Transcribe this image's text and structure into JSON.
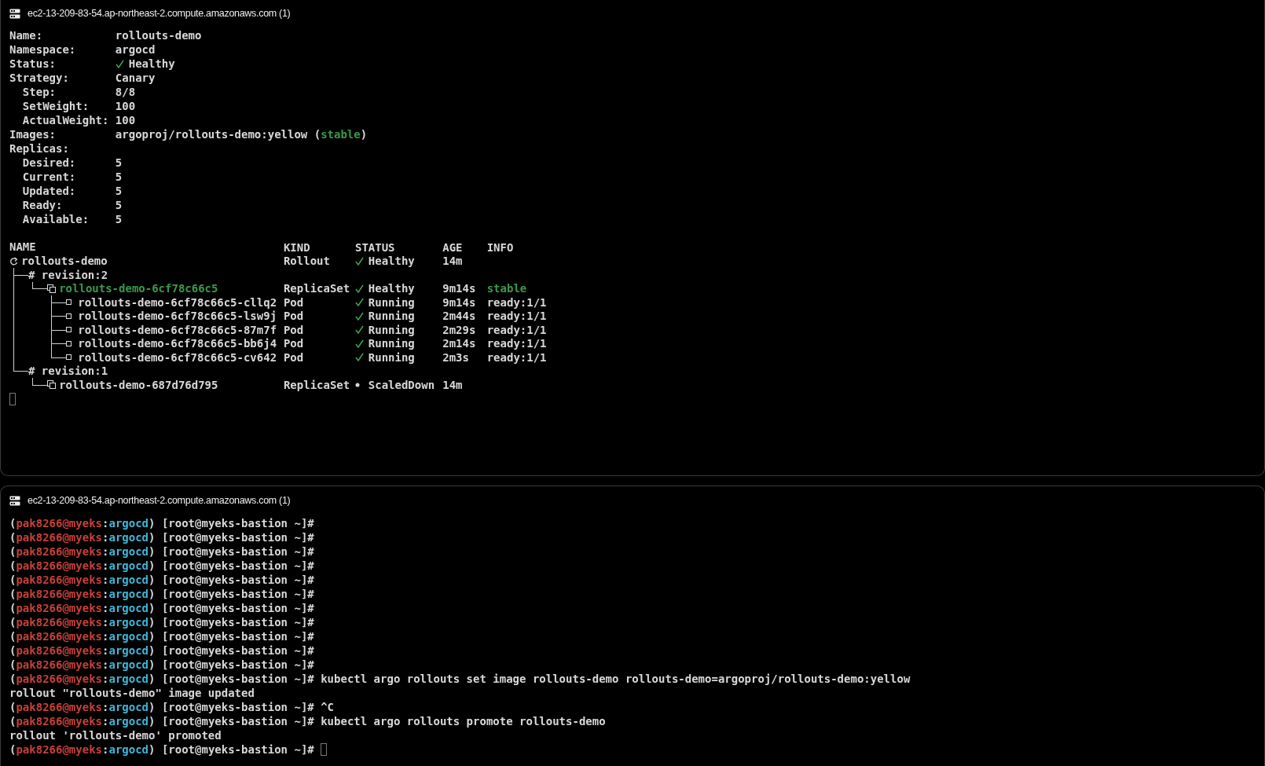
{
  "panes": [
    {
      "kind": "rollout",
      "title": "ec2-13-209-83-54.ap-northeast-2.compute.amazonaws.com (1)",
      "details": [
        {
          "label": "Name:",
          "indent": false,
          "parts": [
            {
              "text": "rollouts-demo",
              "kind": "plain"
            }
          ]
        },
        {
          "label": "Namespace:",
          "indent": false,
          "parts": [
            {
              "text": "argocd",
              "kind": "plain"
            }
          ]
        },
        {
          "label": "Status:",
          "indent": false,
          "parts": [
            {
              "text": "Healthy",
              "kind": "healthy"
            }
          ]
        },
        {
          "label": "Strategy:",
          "indent": false,
          "parts": [
            {
              "text": "Canary",
              "kind": "plain"
            }
          ]
        },
        {
          "label": "Step:",
          "indent": true,
          "parts": [
            {
              "text": "8/8",
              "kind": "plain"
            }
          ]
        },
        {
          "label": "SetWeight:",
          "indent": true,
          "parts": [
            {
              "text": "100",
              "kind": "plain"
            }
          ]
        },
        {
          "label": "ActualWeight:",
          "indent": true,
          "parts": [
            {
              "text": "100",
              "kind": "plain"
            }
          ]
        },
        {
          "label": "Images:",
          "indent": false,
          "parts": [
            {
              "text": "argoproj/rollouts-demo:yellow (",
              "kind": "plain"
            },
            {
              "text": "stable",
              "kind": "stable"
            },
            {
              "text": ")",
              "kind": "plain"
            }
          ]
        },
        {
          "label": "Replicas:",
          "indent": false
        },
        {
          "label": "Desired:",
          "indent": true,
          "parts": [
            {
              "text": "5",
              "kind": "plain"
            }
          ]
        },
        {
          "label": "Current:",
          "indent": true,
          "parts": [
            {
              "text": "5",
              "kind": "plain"
            }
          ]
        },
        {
          "label": "Updated:",
          "indent": true,
          "parts": [
            {
              "text": "5",
              "kind": "plain"
            }
          ]
        },
        {
          "label": "Ready:",
          "indent": true,
          "parts": [
            {
              "text": "5",
              "kind": "plain"
            }
          ]
        },
        {
          "label": "Available:",
          "indent": true,
          "parts": [
            {
              "text": "5",
              "kind": "plain"
            }
          ]
        }
      ],
      "tree": {
        "columns": [
          "NAME",
          "KIND",
          "STATUS",
          "AGE",
          "INFO"
        ],
        "root": {
          "kind": "rollout",
          "name": "rollouts-demo",
          "color": "#d8d8d8",
          "resource_kind": "Rollout",
          "status": {
            "text": "Healthy",
            "kind": "ok"
          },
          "age": "14m",
          "children": [
            {
              "name": "# revision:2",
              "color": "#d8d8d8",
              "children": [
                {
                  "kind": "replicaset",
                  "name": "rollouts-demo-6cf78c66c5",
                  "color": "#3a9a4a",
                  "resource_kind": "ReplicaSet",
                  "status": {
                    "text": "Healthy",
                    "kind": "ok"
                  },
                  "age": "9m14s",
                  "info": "stable",
                  "children": [
                    {
                      "kind": "pod",
                      "name": "rollouts-demo-6cf78c66c5-cllq2",
                      "color": "#d8d8d8",
                      "resource_kind": "Pod",
                      "status": {
                        "text": "Running",
                        "kind": "ok"
                      },
                      "age": "9m14s",
                      "info": "ready:1/1"
                    },
                    {
                      "kind": "pod",
                      "name": "rollouts-demo-6cf78c66c5-lsw9j",
                      "color": "#d8d8d8",
                      "resource_kind": "Pod",
                      "status": {
                        "text": "Running",
                        "kind": "ok"
                      },
                      "age": "2m44s",
                      "info": "ready:1/1"
                    },
                    {
                      "kind": "pod",
                      "name": "rollouts-demo-6cf78c66c5-87m7f",
                      "color": "#d8d8d8",
                      "resource_kind": "Pod",
                      "status": {
                        "text": "Running",
                        "kind": "ok"
                      },
                      "age": "2m29s",
                      "info": "ready:1/1"
                    },
                    {
                      "kind": "pod",
                      "name": "rollouts-demo-6cf78c66c5-bb6j4",
                      "color": "#d8d8d8",
                      "resource_kind": "Pod",
                      "status": {
                        "text": "Running",
                        "kind": "ok"
                      },
                      "age": "2m14s",
                      "info": "ready:1/1"
                    },
                    {
                      "kind": "pod",
                      "name": "rollouts-demo-6cf78c66c5-cv642",
                      "color": "#d8d8d8",
                      "resource_kind": "Pod",
                      "status": {
                        "text": "Running",
                        "kind": "ok"
                      },
                      "age": "2m3s",
                      "info": "ready:1/1"
                    }
                  ]
                }
              ]
            },
            {
              "name": "# revision:1",
              "color": "#d8d8d8",
              "children": [
                {
                  "kind": "replicaset",
                  "name": "rollouts-demo-687d76d795",
                  "color": "#d8d8d8",
                  "resource_kind": "ReplicaSet",
                  "status": {
                    "text": "ScaledDown",
                    "kind": "down"
                  },
                  "age": "14m"
                }
              ]
            }
          ]
        }
      },
      "cursor": true
    },
    {
      "kind": "shell",
      "title": "ec2-13-209-83-54.ap-northeast-2.compute.amazonaws.com (1)",
      "lines": [
        {
          "kind": "prompt",
          "prefix": "(",
          "user": "pak8266@myeks",
          "sep": ":",
          "context": "argocd",
          "suffix": ") [root@myeks-bastion ~]#",
          "cursor": false
        },
        {
          "kind": "prompt",
          "prefix": "(",
          "user": "pak8266@myeks",
          "sep": ":",
          "context": "argocd",
          "suffix": ") [root@myeks-bastion ~]#",
          "cursor": false
        },
        {
          "kind": "prompt",
          "prefix": "(",
          "user": "pak8266@myeks",
          "sep": ":",
          "context": "argocd",
          "suffix": ") [root@myeks-bastion ~]#",
          "cursor": false
        },
        {
          "kind": "prompt",
          "prefix": "(",
          "user": "pak8266@myeks",
          "sep": ":",
          "context": "argocd",
          "suffix": ") [root@myeks-bastion ~]#",
          "cursor": false
        },
        {
          "kind": "prompt",
          "prefix": "(",
          "user": "pak8266@myeks",
          "sep": ":",
          "context": "argocd",
          "suffix": ") [root@myeks-bastion ~]#",
          "cursor": false
        },
        {
          "kind": "prompt",
          "prefix": "(",
          "user": "pak8266@myeks",
          "sep": ":",
          "context": "argocd",
          "suffix": ") [root@myeks-bastion ~]#",
          "cursor": false
        },
        {
          "kind": "prompt",
          "prefix": "(",
          "user": "pak8266@myeks",
          "sep": ":",
          "context": "argocd",
          "suffix": ") [root@myeks-bastion ~]#",
          "cursor": false
        },
        {
          "kind": "prompt",
          "prefix": "(",
          "user": "pak8266@myeks",
          "sep": ":",
          "context": "argocd",
          "suffix": ") [root@myeks-bastion ~]#",
          "cursor": false
        },
        {
          "kind": "prompt",
          "prefix": "(",
          "user": "pak8266@myeks",
          "sep": ":",
          "context": "argocd",
          "suffix": ") [root@myeks-bastion ~]#",
          "cursor": false
        },
        {
          "kind": "prompt",
          "prefix": "(",
          "user": "pak8266@myeks",
          "sep": ":",
          "context": "argocd",
          "suffix": ") [root@myeks-bastion ~]#",
          "cursor": false
        },
        {
          "kind": "prompt",
          "prefix": "(",
          "user": "pak8266@myeks",
          "sep": ":",
          "context": "argocd",
          "suffix": ") [root@myeks-bastion ~]#",
          "cursor": false
        },
        {
          "kind": "prompt",
          "prefix": "(",
          "user": "pak8266@myeks",
          "sep": ":",
          "context": "argocd",
          "suffix": ") [root@myeks-bastion ~]#",
          "command": "kubectl argo rollouts set image rollouts-demo rollouts-demo=argoproj/rollouts-demo:yellow",
          "cursor": false
        },
        {
          "kind": "output",
          "text": "rollout \"rollouts-demo\" image updated",
          "cursor": false
        },
        {
          "kind": "prompt",
          "prefix": "(",
          "user": "pak8266@myeks",
          "sep": ":",
          "context": "argocd",
          "suffix": ") [root@myeks-bastion ~]#",
          "command": "^C",
          "cursor": false
        },
        {
          "kind": "prompt",
          "prefix": "(",
          "user": "pak8266@myeks",
          "sep": ":",
          "context": "argocd",
          "suffix": ") [root@myeks-bastion ~]#",
          "command": "kubectl argo rollouts promote rollouts-demo",
          "cursor": false
        },
        {
          "kind": "output",
          "text": "rollout 'rollouts-demo' promoted",
          "cursor": false
        },
        {
          "kind": "prompt",
          "prefix": "(",
          "user": "pak8266@myeks",
          "sep": ":",
          "context": "argocd",
          "suffix": ") [root@myeks-bastion ~]#",
          "cursor": true
        }
      ]
    }
  ]
}
